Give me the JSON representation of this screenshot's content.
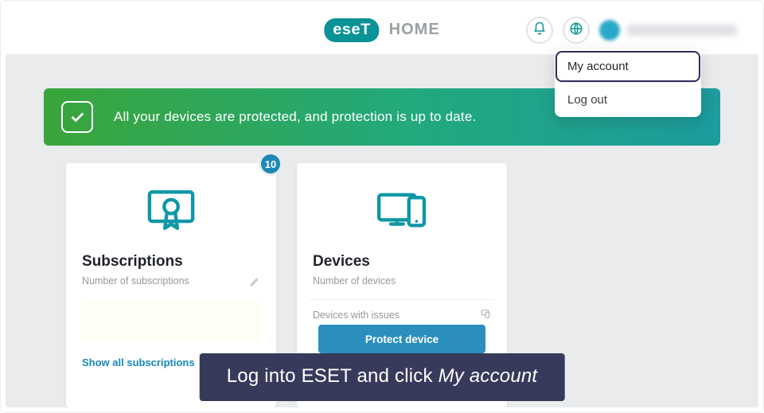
{
  "brand": {
    "logo_text": "eseT",
    "home": "HOME"
  },
  "dropdown": {
    "my_account": "My account",
    "log_out": "Log out"
  },
  "banner": {
    "text": "All your devices are protected, and protection is up to date."
  },
  "subs_card": {
    "badge": "10",
    "title": "Subscriptions",
    "sub": "Number of subscriptions",
    "link": "Show all subscriptions"
  },
  "devices_card": {
    "title": "Devices",
    "sub": "Number of devices",
    "issues": "Devices with issues",
    "protect_btn": "Protect device"
  },
  "caption": {
    "pre": "Log into ESET and click ",
    "em": "My account"
  },
  "colors": {
    "accent": "#0a9396",
    "blue": "#1e88b8",
    "caption_bg": "#373a5a"
  }
}
